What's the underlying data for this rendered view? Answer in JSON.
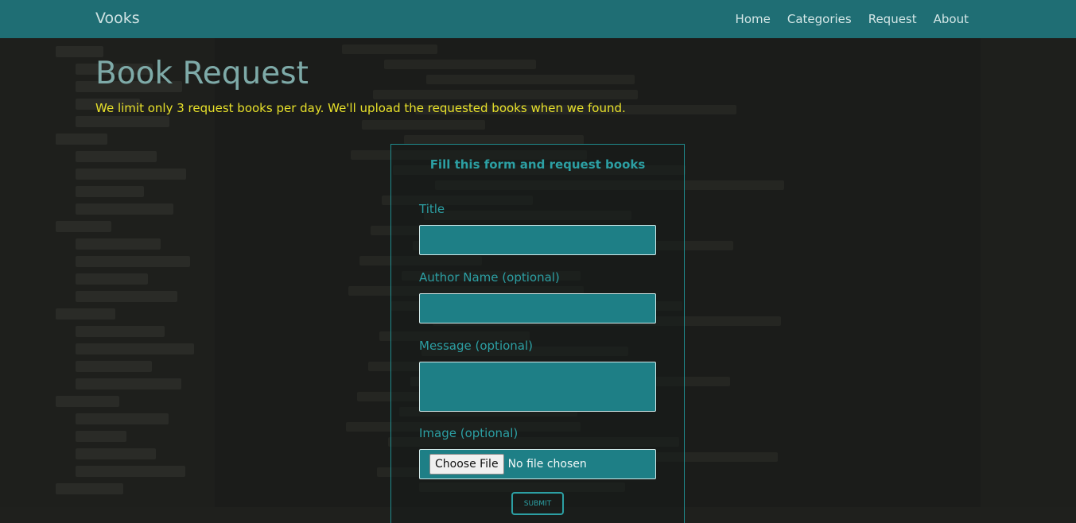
{
  "navbar": {
    "brand": "Vooks",
    "links": [
      "Home",
      "Categories",
      "Request",
      "About"
    ]
  },
  "page": {
    "title": "Book Request",
    "notice": "We limit only 3 request books per day. We'll upload the requested books when we found."
  },
  "form": {
    "heading": "Fill this form and request books",
    "title_label": "Title",
    "title_value": "",
    "author_label": "Author Name (optional)",
    "author_value": "",
    "message_label": "Message (optional)",
    "message_value": "",
    "image_label": "Image (optional)",
    "file_button": "Choose File",
    "file_status": "No file chosen",
    "submit_label": "SUBMIT"
  },
  "colors": {
    "navbar": "#1f6e74",
    "accent": "#2c9fa3",
    "notice": "#e7e02a",
    "input_bg": "#1e7f86"
  }
}
